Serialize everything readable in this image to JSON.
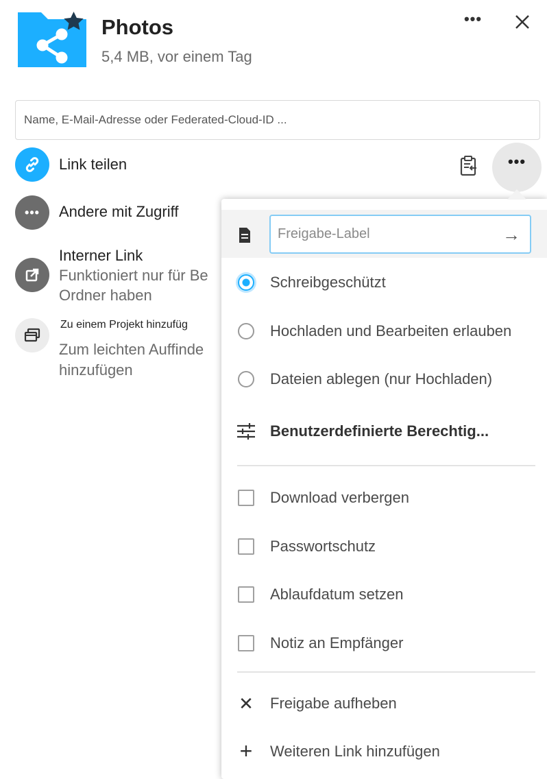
{
  "header": {
    "title": "Photos",
    "subtitle": "5,4 MB, vor einem Tag",
    "more_label": "•••",
    "folder_icon": "shared-folder-icon",
    "close_icon": "close-icon"
  },
  "search": {
    "placeholder": "Name, E-Mail-Adresse oder Federated-Cloud-ID ..."
  },
  "sharing": {
    "link_share": {
      "label": "Link teilen",
      "icon": "link-icon"
    },
    "clipboard_icon": "clipboard-icon",
    "link_more_label": "•••",
    "others": {
      "label": "Andere mit Zugriff",
      "icon_text": "•••"
    },
    "internal_link": {
      "label": "Interner Link",
      "line1": "Funktioniert nur für Be",
      "line2": "Ordner haben",
      "icon": "external-link-icon"
    },
    "project": {
      "label": "Zu einem Projekt hinzufüg",
      "line1": "Zum leichten Auffinde",
      "line2": "hinzufügen",
      "icon": "projects-icon"
    }
  },
  "menu": {
    "label_input": {
      "placeholder": "Freigabe-Label",
      "submit": "→"
    },
    "permissions": [
      {
        "label": "Schreibgeschützt",
        "selected": true
      },
      {
        "label": "Hochladen und Bearbeiten erlauben",
        "selected": false
      },
      {
        "label": "Dateien ablegen (nur Hochladen)",
        "selected": false
      }
    ],
    "custom_permissions": "Benutzerdefinierte Berechtig...",
    "options": [
      {
        "label": "Download verbergen",
        "checked": false
      },
      {
        "label": "Passwortschutz",
        "checked": false
      },
      {
        "label": "Ablaufdatum setzen",
        "checked": false
      },
      {
        "label": "Notiz an Empfänger",
        "checked": false
      }
    ],
    "unshare": "Freigabe aufheben",
    "add_link": "Weiteren Link hinzufügen",
    "unshare_symbol": "✕",
    "add_symbol": "+"
  },
  "colors": {
    "accent": "#1cafff",
    "icon_grey": "#6c6c6c"
  }
}
